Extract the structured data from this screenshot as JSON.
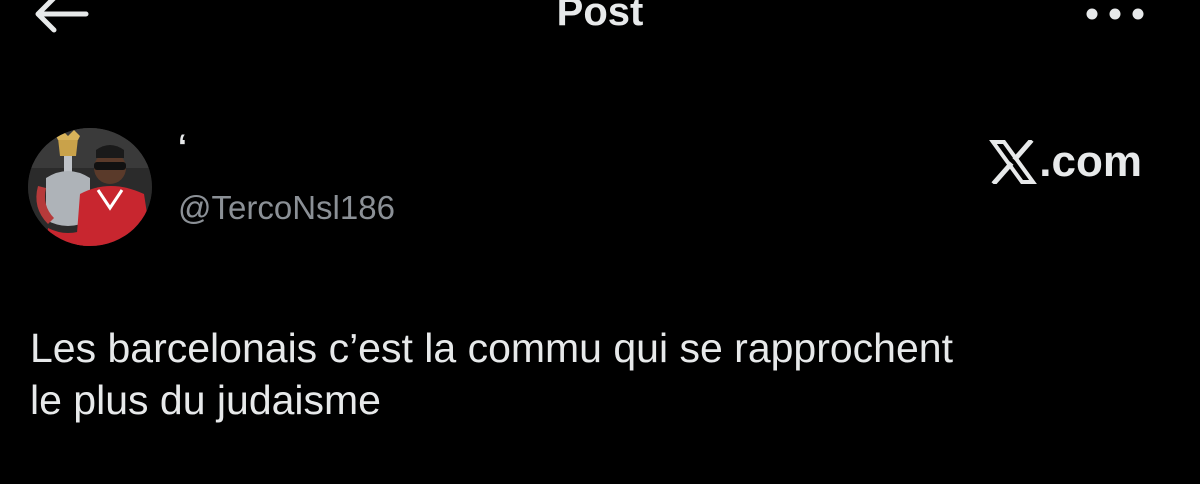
{
  "header": {
    "title": "Post",
    "back_icon": "arrow-left-icon",
    "more_icon": "more-horizontal-icon"
  },
  "post": {
    "author": {
      "display_name": "‘",
      "handle": "@TercoNsl186",
      "avatar_icon": "avatar-photo"
    },
    "source_logo": "X",
    "source_text": ".com",
    "text": "Les barcelonais c’est la commu qui se rapprochent\nle plus du judaisme"
  },
  "colors": {
    "background": "#000000",
    "primary_text": "#e7e9ea",
    "secondary_text": "#8b9096"
  }
}
